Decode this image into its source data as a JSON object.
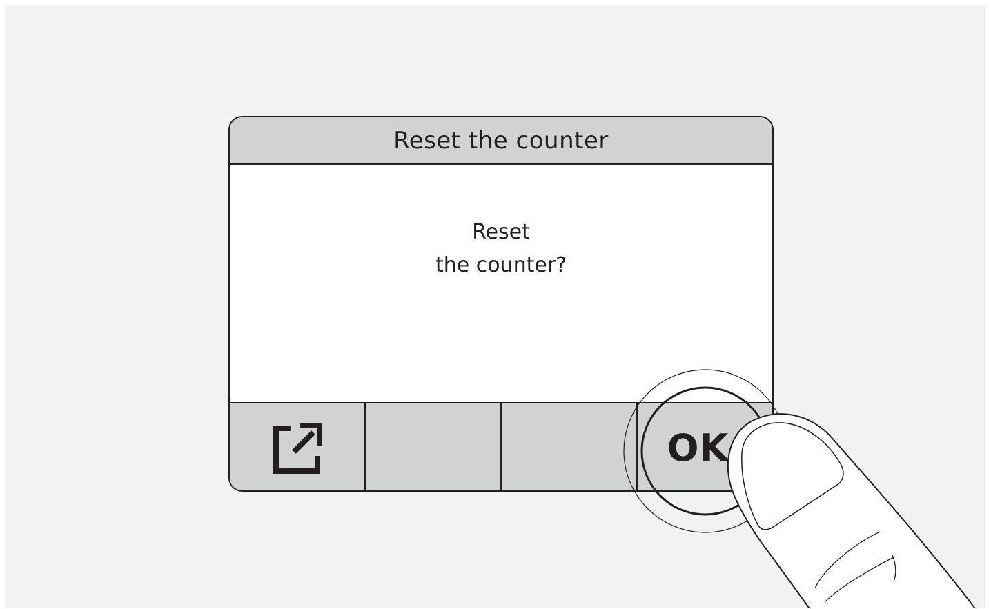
{
  "dialog": {
    "title": "Reset the counter",
    "message_line1": "Reset",
    "message_line2": "the counter?"
  },
  "softkeys": {
    "key1_icon": "export-icon",
    "key2_label": "",
    "key3_label": "",
    "key4_label": "OK"
  },
  "colors": {
    "background": "#f1f2f4",
    "panel": "#d1d2d4",
    "screen": "#ffffff",
    "ink": "#231f20"
  }
}
